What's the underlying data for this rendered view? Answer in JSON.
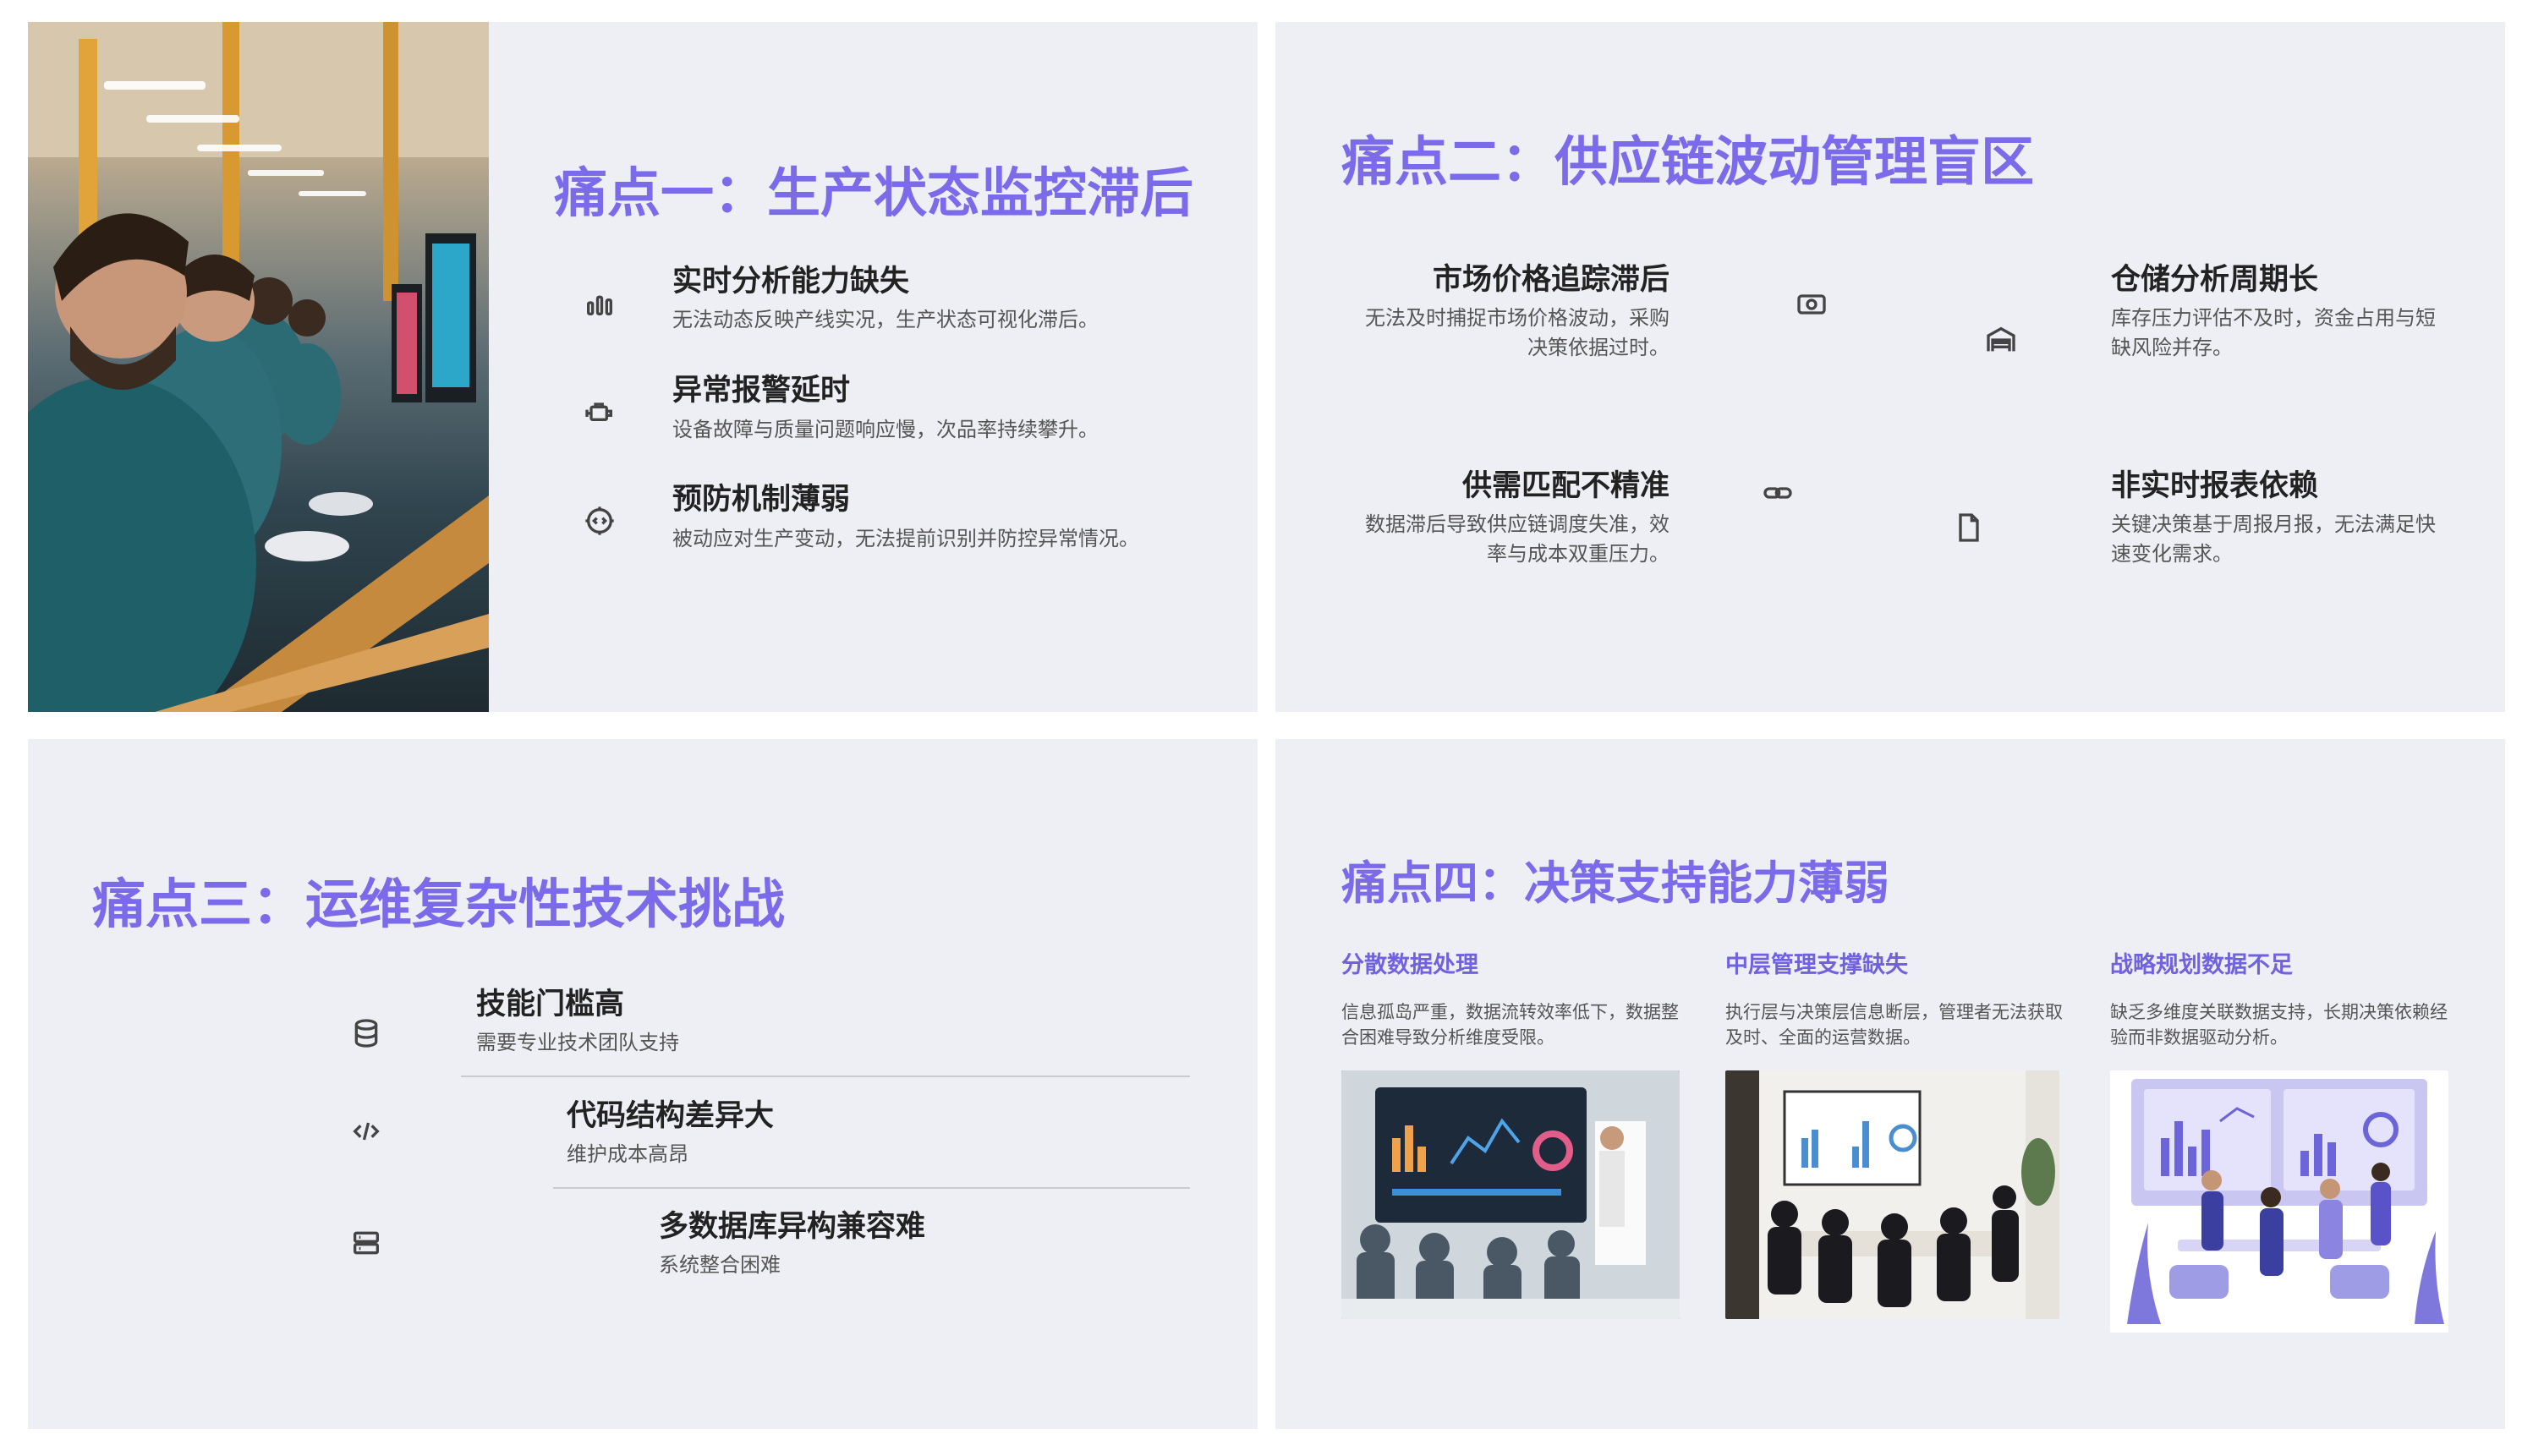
{
  "slide1": {
    "title": "痛点一：生产状态监控滞后",
    "items": [
      {
        "icon": "bar-chart-icon",
        "heading": "实时分析能力缺失",
        "desc": "无法动态反映产线实况，生产状态可视化滞后。"
      },
      {
        "icon": "engine-icon",
        "heading": "异常报警延时",
        "desc": "设备故障与质量问题响应慢，次品率持续攀升。"
      },
      {
        "icon": "gear-code-icon",
        "heading": "预防机制薄弱",
        "desc": "被动应对生产变动，无法提前识别并防控异常情况。"
      }
    ]
  },
  "slide2": {
    "title": "痛点二：供应链波动管理盲区",
    "items": [
      {
        "icon": "banknote-icon",
        "heading": "市场价格追踪滞后",
        "desc": "无法及时捕捉市场价格波动，采购决策依据过时。"
      },
      {
        "icon": "warehouse-icon",
        "heading": "仓储分析周期长",
        "desc": "库存压力评估不及时，资金占用与短缺风险并存。"
      },
      {
        "icon": "link-icon",
        "heading": "供需匹配不精准",
        "desc": "数据滞后导致供应链调度失准，效率与成本双重压力。"
      },
      {
        "icon": "file-icon",
        "heading": "非实时报表依赖",
        "desc": "关键决策基于周报月报，无法满足快速变化需求。"
      }
    ]
  },
  "slide3": {
    "title": "痛点三：运维复杂性技术挑战",
    "items": [
      {
        "icon": "database-icon",
        "heading": "技能门槛高",
        "desc": "需要专业技术团队支持"
      },
      {
        "icon": "code-icon",
        "heading": "代码结构差异大",
        "desc": "维护成本高昂"
      },
      {
        "icon": "server-icon",
        "heading": "多数据库异构兼容难",
        "desc": "系统整合困难"
      }
    ]
  },
  "slide4": {
    "title": "痛点四：决策支持能力薄弱",
    "columns": [
      {
        "heading": "分散数据处理",
        "desc": "信息孤岛严重，数据流转效率低下，数据整合困难导致分析维度受限。"
      },
      {
        "heading": "中层管理支撑缺失",
        "desc": "执行层与决策层信息断层，管理者无法获取及时、全面的运营数据。"
      },
      {
        "heading": "战略规划数据不足",
        "desc": "缺乏多维度关联数据支持，长期决策依赖经验而非数据驱动分析。"
      }
    ]
  },
  "colors": {
    "accent": "#7b6bea",
    "slide_bg": "#eeeff4"
  }
}
